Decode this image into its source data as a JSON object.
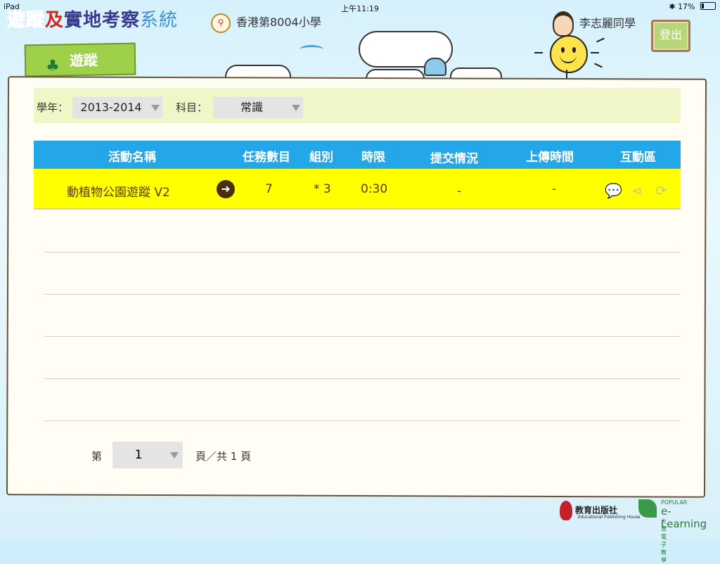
{
  "status_bar": {
    "device": "iPad",
    "time": "上午11:19",
    "battery": "17%"
  },
  "header": {
    "logo_part1": "遊蹤",
    "logo_part2": "及",
    "logo_part3": "實地考察",
    "logo_part4": "系統",
    "school_name": "香港第8004小學",
    "user_name": "李志麗同學",
    "logout_label": "登出"
  },
  "tab": {
    "label": "遊蹤"
  },
  "filters": {
    "year_label": "學年：",
    "year_value": "2013-2014",
    "subject_label": "科目：",
    "subject_value": "常識"
  },
  "table": {
    "headers": [
      "活動名稱",
      "任務數目",
      "組別",
      "時限",
      "提交情況",
      "上傳時間",
      "互動區"
    ],
    "rows": [
      {
        "name": "動植物公園遊蹤 V2",
        "tasks": "7",
        "group": "* 3",
        "time_limit": "0:30",
        "submission": "-",
        "upload_time": "-"
      }
    ]
  },
  "pagination": {
    "prefix": "第",
    "current": "1",
    "suffix": "頁／共 1 頁"
  },
  "footer": {
    "publisher_cn": "教育出版社",
    "publisher_en": "Educational Publishing House",
    "elearning_small": "POPULAR",
    "elearning_big": "e-Learning",
    "elearning_cn": "大眾電子教學"
  },
  "icons": {
    "enter": "arrow-right-circle-icon",
    "comment": "chat-bubble-icon",
    "share": "share-icon",
    "refresh": "refresh-icon"
  },
  "colors": {
    "header_blue": "#23a7e8",
    "row_yellow": "#ffff00",
    "tab_green": "#9fd04a",
    "filter_bg": "#eff7c8"
  }
}
